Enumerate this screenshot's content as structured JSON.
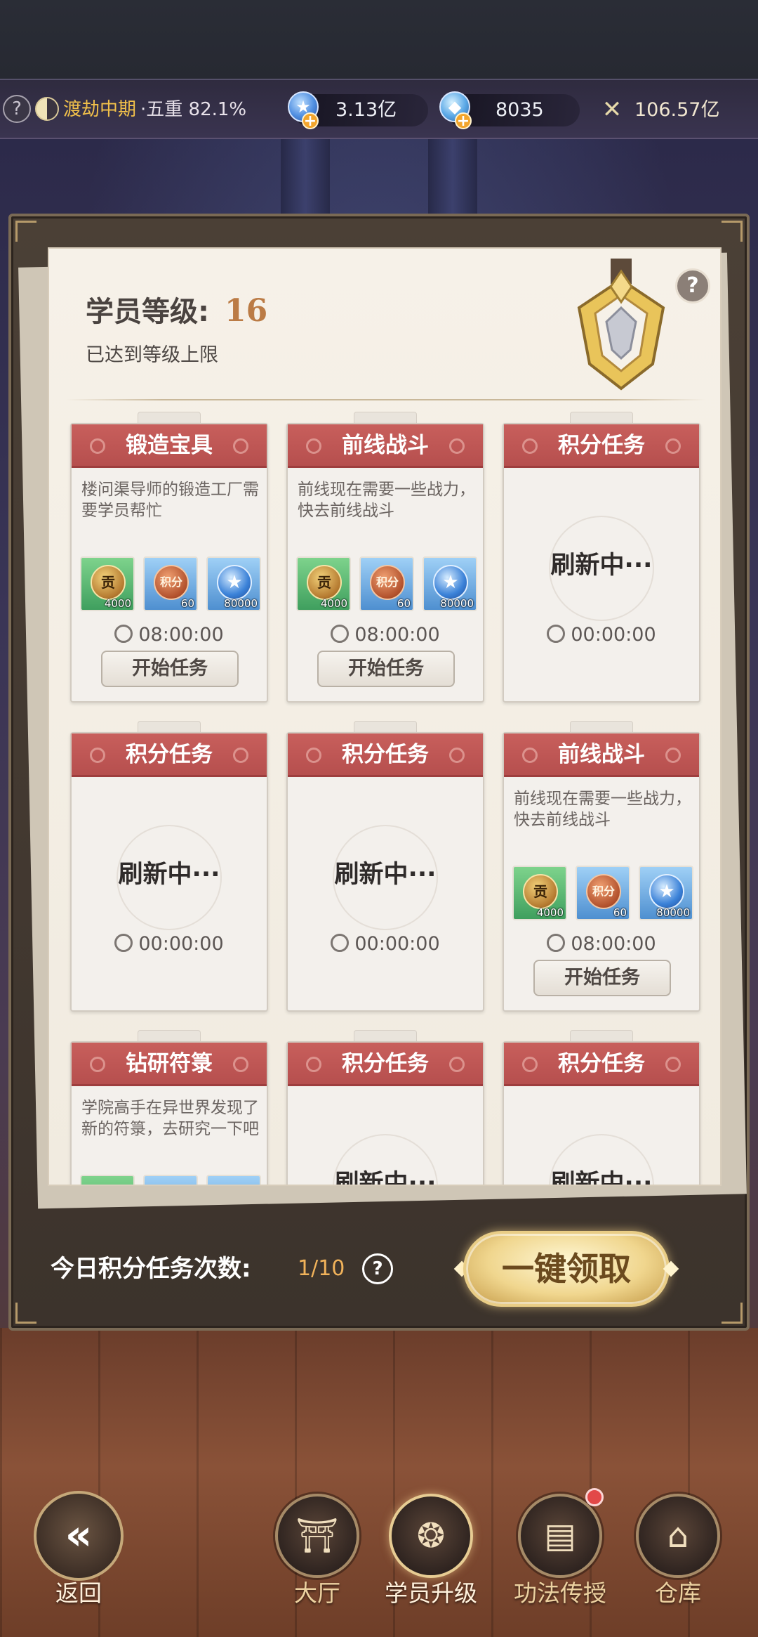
{
  "status_bar": {
    "realm": "渡劫中期",
    "realm_detail": "·五重 82.1%",
    "currency_1": "3.13亿",
    "currency_2": "8035",
    "power": "106.57亿",
    "help_glyph": "?",
    "icons": [
      "help-icon",
      "yinyang-icon",
      "star-coin-icon",
      "dragon-gem-icon",
      "crossed-swords-icon"
    ]
  },
  "panel": {
    "title": "学员等级:",
    "level": "16",
    "subtitle": "已达到等级上限",
    "help_glyph": "?"
  },
  "tasks": [
    {
      "title": "锻造宝具",
      "desc": "楼问渠导师的锻造工厂需要学员帮忙",
      "rewards": [
        {
          "icon": "gong-coin",
          "label": "贡",
          "amount": "4000"
        },
        {
          "icon": "points-coin",
          "label": "积分",
          "amount": "60"
        },
        {
          "icon": "star-coin",
          "label": "★",
          "amount": "80000"
        }
      ],
      "timer": "08:00:00",
      "button": "开始任务"
    },
    {
      "title": "前线战斗",
      "desc": "前线现在需要一些战力，快去前线战斗",
      "rewards": [
        {
          "icon": "gong-coin",
          "label": "贡",
          "amount": "4000"
        },
        {
          "icon": "points-coin",
          "label": "积分",
          "amount": "60"
        },
        {
          "icon": "star-coin",
          "label": "★",
          "amount": "80000"
        }
      ],
      "timer": "08:00:00",
      "button": "开始任务"
    },
    {
      "title": "积分任务",
      "refresh": "刷新中···",
      "timer": "00:00:00"
    },
    {
      "title": "积分任务",
      "refresh": "刷新中···",
      "timer": "00:00:00"
    },
    {
      "title": "积分任务",
      "refresh": "刷新中···",
      "timer": "00:00:00"
    },
    {
      "title": "前线战斗",
      "desc": "前线现在需要一些战力，快去前线战斗",
      "rewards": [
        {
          "icon": "gong-coin",
          "label": "贡",
          "amount": "4000"
        },
        {
          "icon": "points-coin",
          "label": "积分",
          "amount": "60"
        },
        {
          "icon": "star-coin",
          "label": "★",
          "amount": "80000"
        }
      ],
      "timer": "08:00:00",
      "button": "开始任务"
    },
    {
      "title": "钻研符箓",
      "desc": "学院高手在异世界发现了新的符箓，去研究一下吧"
    },
    {
      "title": "积分任务",
      "refresh": "刷新中···"
    },
    {
      "title": "积分任务",
      "refresh": "刷新中···"
    }
  ],
  "footer": {
    "daily_label": "今日积分任务次数:",
    "daily_count": "1/10",
    "help_glyph": "?",
    "claim_all": "一键领取"
  },
  "nav": {
    "back": "返回",
    "items": [
      {
        "label": "大厅",
        "icon": "hall-icon"
      },
      {
        "label": "学员升级",
        "icon": "upgrade-icon",
        "active": true
      },
      {
        "label": "功法传授",
        "icon": "scroll-book-icon",
        "notification": true
      },
      {
        "label": "仓库",
        "icon": "warehouse-icon"
      }
    ]
  }
}
